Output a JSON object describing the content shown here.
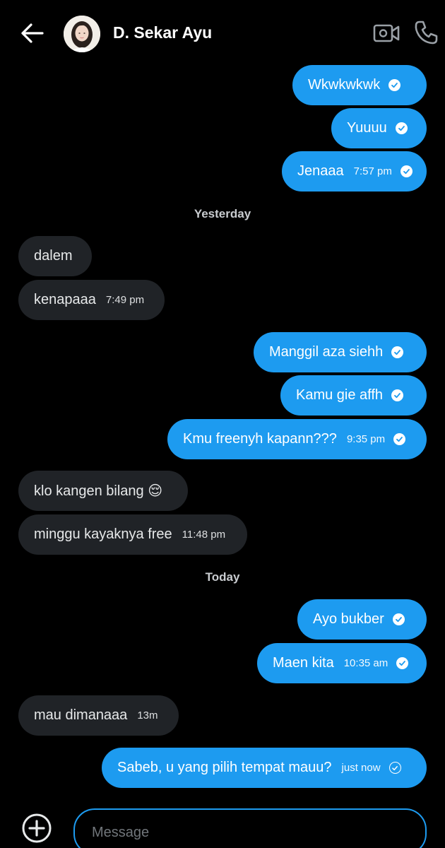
{
  "header": {
    "back_icon": "arrow-left-icon",
    "contact_name": "D. Sekar Ayu",
    "video_icon": "video-camera-icon",
    "call_icon": "phone-icon"
  },
  "colors": {
    "background": "#000000",
    "outgoing_bubble": "#1d9bf0",
    "incoming_bubble": "#202327",
    "accent": "#1d9bf0"
  },
  "messages": [
    {
      "text": "Wkwkwkwk",
      "dir": "out",
      "time": "",
      "status": "read"
    },
    {
      "text": "Yuuuu",
      "dir": "out",
      "time": "",
      "status": "read"
    },
    {
      "text": "Jenaaa",
      "dir": "out",
      "time": "7:57 pm",
      "status": "read"
    },
    {
      "separator": "Yesterday"
    },
    {
      "text": "dalem",
      "dir": "in",
      "time": ""
    },
    {
      "text": "kenapaaa",
      "dir": "in",
      "time": "7:49 pm"
    },
    {
      "text": "Manggil aza siehh",
      "dir": "out",
      "time": "",
      "status": "read"
    },
    {
      "text": "Kamu gie affh",
      "dir": "out",
      "time": "",
      "status": "read"
    },
    {
      "text": "Kmu freenyh kapann???",
      "dir": "out",
      "time": "9:35 pm",
      "status": "read"
    },
    {
      "text": "klo kangen bilang 😌",
      "dir": "in",
      "time": ""
    },
    {
      "text": "minggu kayaknya free",
      "dir": "in",
      "time": "11:48 pm"
    },
    {
      "separator": "Today"
    },
    {
      "text": "Ayo bukber",
      "dir": "out",
      "time": "",
      "status": "read"
    },
    {
      "text": "Maen kita",
      "dir": "out",
      "time": "10:35 am",
      "status": "read"
    },
    {
      "text": "mau dimanaaa",
      "dir": "in",
      "time": "13m"
    },
    {
      "text": "Sabeb, u yang pilih tempat mauu?",
      "dir": "out",
      "time": "just now",
      "status": "sent"
    }
  ],
  "composer": {
    "add_icon": "plus-circle-icon",
    "placeholder": "Message"
  }
}
